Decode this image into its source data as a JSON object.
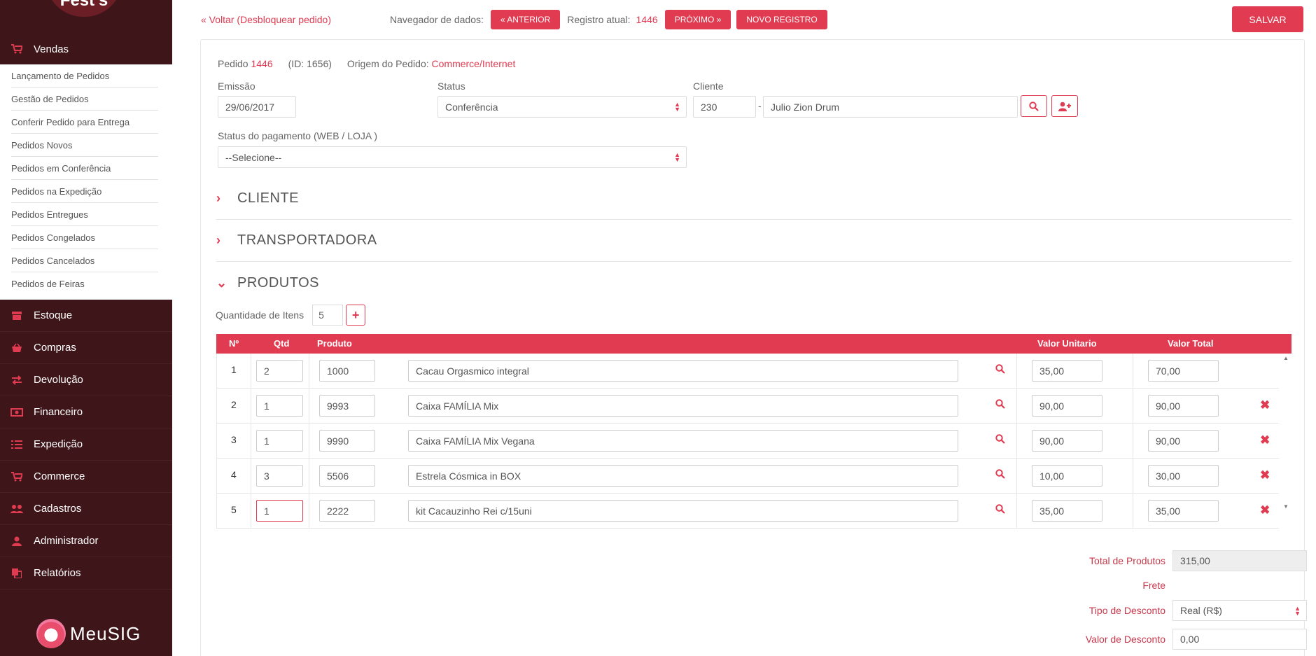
{
  "sidebar": {
    "logo_text": "Fest's",
    "active_section": "Vendas",
    "submenu": [
      "Lançamento de Pedidos",
      "Gestão de Pedidos",
      "Conferir Pedido para Entrega",
      "Pedidos Novos",
      "Pedidos em Conferência",
      "Pedidos na Expedição",
      "Pedidos Entregues",
      "Pedidos Congelados",
      "Pedidos Cancelados",
      "Pedidos de Feiras"
    ],
    "items": [
      "Estoque",
      "Compras",
      "Devolução",
      "Financeiro",
      "Expedição",
      "Commerce",
      "Cadastros",
      "Administrador",
      "Relatórios"
    ],
    "brand": "MeuSIG"
  },
  "topbar": {
    "back_link": "« Voltar (Desbloquear pedido)",
    "navigator_label": "Navegador de dados:",
    "prev_label": "« ANTERIOR",
    "current_label": "Registro atual:",
    "current_value": "1446",
    "next_label": "PRÓXIMO »",
    "new_label": "NOVO REGISTRO",
    "save_label": "SALVAR"
  },
  "order": {
    "pedido_label": "Pedido",
    "pedido_num": "1446",
    "id_text": "(ID: 1656)",
    "origem_label": "Origem do Pedido:",
    "origem_value": "Commerce/Internet",
    "emissao_label": "Emissão",
    "emissao_value": "29/06/2017",
    "status_label": "Status",
    "status_value": "Conferência",
    "cliente_label": "Cliente",
    "cliente_code": "230",
    "cliente_sep": "-",
    "cliente_name": "Julio Zion Drum",
    "pagamento_label": "Status do pagamento (WEB / LOJA )",
    "pagamento_value": "--Selecione--"
  },
  "sections": {
    "cliente": "CLIENTE",
    "transportadora": "TRANSPORTADORA",
    "produtos": "PRODUTOS"
  },
  "produtos": {
    "qty_label": "Quantidade de Itens",
    "qty_value": "5",
    "columns": [
      "Nº",
      "Qtd",
      "Produto",
      "Valor Unitario",
      "Valor Total"
    ],
    "rows": [
      {
        "n": "1",
        "qtd": "2",
        "code": "1000",
        "name": "Cacau Orgasmico integral",
        "unit": "35,00",
        "total": "70,00"
      },
      {
        "n": "2",
        "qtd": "1",
        "code": "9993",
        "name": "Caixa FAMÍLIA Mix",
        "unit": "90,00",
        "total": "90,00"
      },
      {
        "n": "3",
        "qtd": "1",
        "code": "9990",
        "name": "Caixa FAMÍLIA Mix Vegana",
        "unit": "90,00",
        "total": "90,00"
      },
      {
        "n": "4",
        "qtd": "3",
        "code": "5506",
        "name": "Estrela Cósmica in BOX",
        "unit": "10,00",
        "total": "30,00"
      },
      {
        "n": "5",
        "qtd": "1",
        "code": "2222",
        "name": "kit Cacauzinho Rei c/15uni",
        "unit": "35,00",
        "total": "35,00"
      }
    ]
  },
  "totals": {
    "total_label": "Total de Produtos",
    "total_value": "315,00",
    "frete_label": "Frete",
    "tipo_label": "Tipo de Desconto",
    "tipo_value": "Real (R$)",
    "valor_label": "Valor de Desconto",
    "valor_value": "0,00"
  },
  "colors": {
    "accent": "#e03b51",
    "sidebar": "#3e1519"
  }
}
